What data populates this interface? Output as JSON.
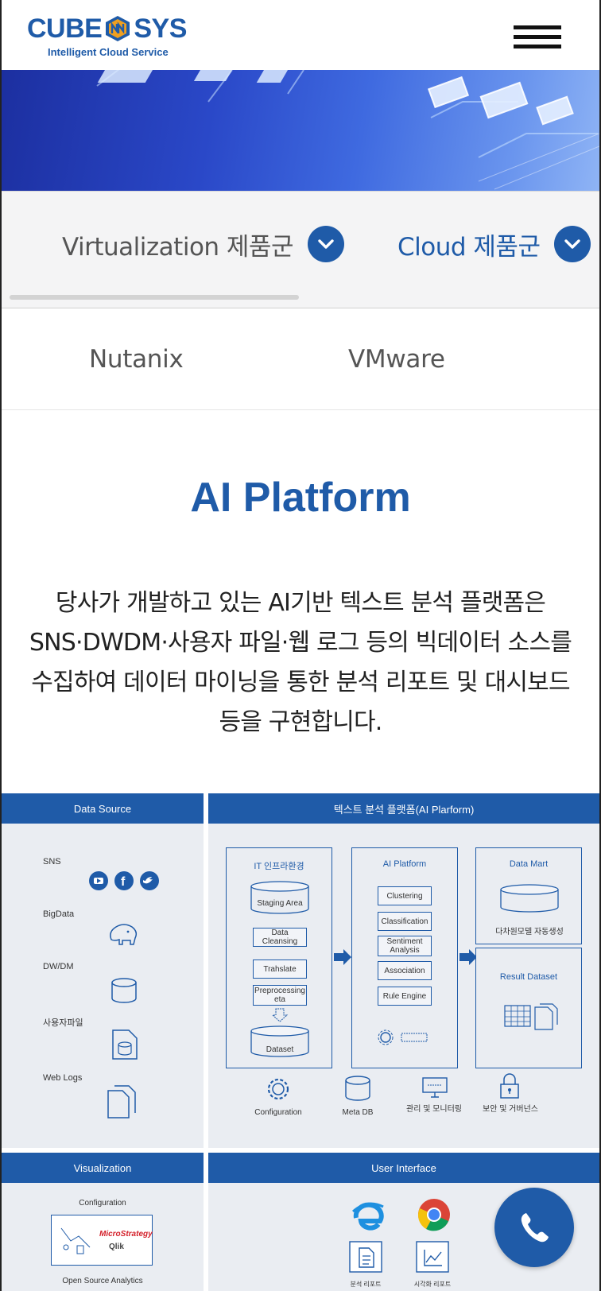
{
  "header": {
    "logo_left": "CUBE",
    "logo_right": "SYS",
    "logo_tagline": "Intelligent Cloud Service"
  },
  "categories": [
    {
      "label": "Virtualization 제품군",
      "active": false
    },
    {
      "label": "Cloud 제품군",
      "active": true
    }
  ],
  "sub_tabs": [
    "Nutanix",
    "VMware"
  ],
  "section": {
    "title": "AI Platform",
    "description": "당사가 개발하고 있는 AI기반 텍스트 분석 플랫폼은 SNS·DWDM·사용자 파일·웹 로그 등의 빅데이터 소스를 수집하여 데이터 마이닝을 통한 분석 리포트 및 대시보드 등을 구현합니다."
  },
  "diagram": {
    "data_source": {
      "title": "Data Source",
      "items": [
        "SNS",
        "BigData",
        "DW/DM",
        "사용자파일",
        "Web Logs"
      ]
    },
    "platform": {
      "title": "텍스트 분석 플랫폼(AI Plarform)",
      "infra": {
        "title": "IT 인프라환경",
        "steps": [
          "Staging Area",
          "Data Cleansing",
          "Trahslate",
          "Preprocessing eta",
          "Dataset"
        ]
      },
      "ai": {
        "title": "AI Platform",
        "modules": [
          "Clustering",
          "Classification",
          "Sentiment Analysis",
          "Association",
          "Rule Engine"
        ]
      },
      "data_mart": {
        "title": "Data Mart",
        "caption": "다차원모델 자동생성"
      },
      "result": {
        "title": "Result Dataset"
      },
      "footer": [
        "Configuration",
        "Meta DB",
        "관리 및 모니터링",
        "보안 및 거버넌스"
      ]
    },
    "visualization": {
      "title": "Visualization",
      "config_label": "Configuration",
      "brand1": "MicroStrategy",
      "brand2": "Qlik",
      "open_source": "Open Source Analytics"
    },
    "user_interface": {
      "title": "User Interface",
      "items": [
        "분석 리포트",
        "시각화 리포트"
      ]
    }
  },
  "colors": {
    "brand": "#1f5ba8",
    "panel_bg": "#eaedf2"
  }
}
